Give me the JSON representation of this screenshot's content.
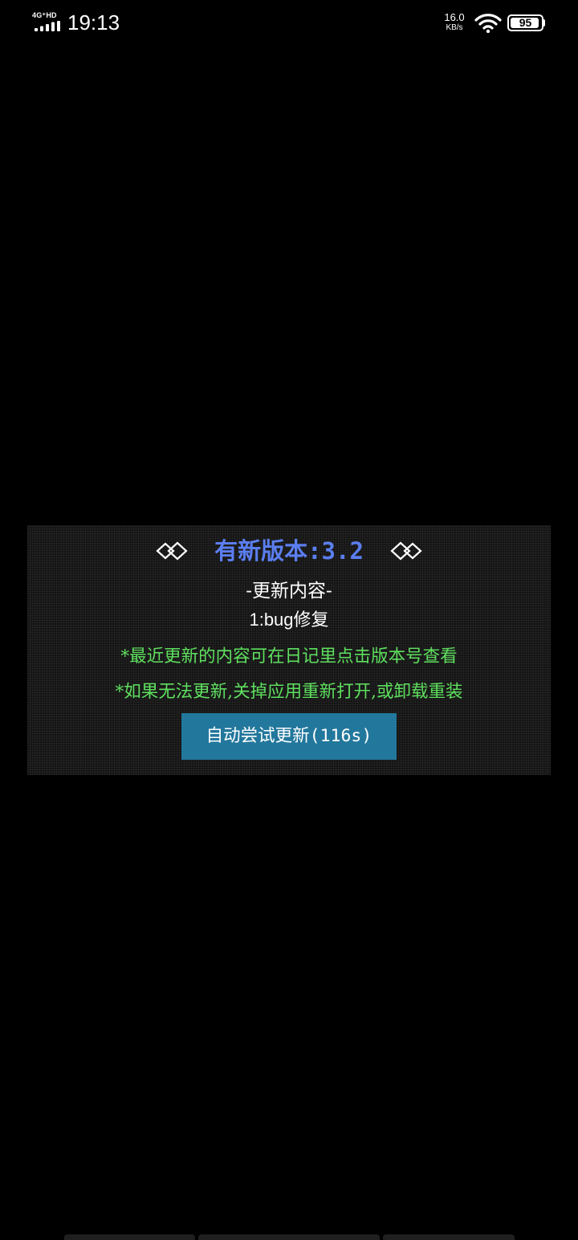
{
  "status_bar": {
    "network_type": "4G⁺HD",
    "time": "19:13",
    "speed_value": "16.0",
    "speed_unit": "KB/s",
    "battery_level": "95",
    "battery_percent": 95,
    "icons": [
      "signal-icon",
      "wifi-icon",
      "battery-icon"
    ]
  },
  "dialog": {
    "title": "有新版本:3.2",
    "section_heading": "-更新内容-",
    "changes": [
      "1:bug修复"
    ],
    "notices": [
      "*最近更新的内容可在日记里点击版本号查看",
      "*如果无法更新,关掉应用重新打开,或卸载重装"
    ],
    "button_label": "自动尝试更新(116s)",
    "colors": {
      "title": "#5b7ef0",
      "notice": "#5ee05e",
      "button": "#22779c",
      "background": "#141414"
    }
  }
}
